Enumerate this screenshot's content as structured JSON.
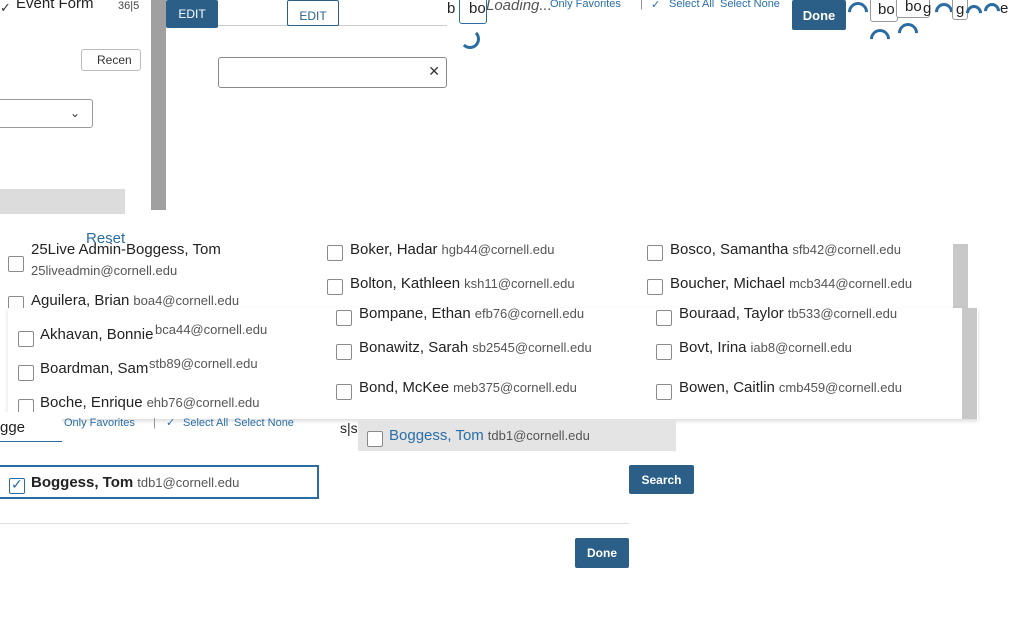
{
  "top_left": {
    "event_form": "Event Form",
    "count_text": "36|5",
    "recent": "Recen"
  },
  "edit_buttons": {
    "edit1": "EDIT",
    "edit2": "EDIT"
  },
  "top_strip": {
    "b1": "b",
    "bo1": "bo",
    "loading": "Loading...",
    "only_favorites": "Only Favorites",
    "sep": "|",
    "select_all": "Select All",
    "select_none": "Select None",
    "done": "Done",
    "bo2": "bo",
    "bo3": "bo",
    "g1": "g",
    "g2": "g",
    "e1": "e"
  },
  "reset": "Reset",
  "people_col1": [
    {
      "name": "25Live Admin-Boggess, Tom",
      "email": "25liveadmin@cornell.edu"
    },
    {
      "name": "Aguilera, Brian",
      "email": "boa4@cornell.edu"
    },
    {
      "name": "Akhavan, Bonnie",
      "email": "bca44@cornell.edu"
    },
    {
      "name": "Boardman, Sam",
      "email": "stb89@cornell.edu"
    },
    {
      "name": "Boche, Enrique",
      "email": "ehb76@cornell.edu"
    }
  ],
  "people_col2": [
    {
      "name": "Boker, Hadar",
      "email": "hgb44@cornell.edu"
    },
    {
      "name": "Bolton, Kathleen",
      "email": "ksh11@cornell.edu"
    },
    {
      "name": "Bompane, Ethan",
      "email": "efb76@cornell.edu"
    },
    {
      "name": "Bonawitz, Sarah",
      "email": "sb2545@cornell.edu"
    },
    {
      "name": "Bond, McKee",
      "email": "meb375@cornell.edu"
    }
  ],
  "people_col3": [
    {
      "name": "Bosco, Samantha",
      "email": "sfb42@cornell.edu"
    },
    {
      "name": "Boucher, Michael",
      "email": "mcb344@cornell.edu"
    },
    {
      "name": "Bouraad, Taylor",
      "email": "tb533@cornell.edu"
    },
    {
      "name": "Bovt, Irina",
      "email": "iab8@cornell.edu"
    },
    {
      "name": "Bowen, Caitlin",
      "email": "cmb459@cornell.edu"
    }
  ],
  "search_row": {
    "query_value": "gge",
    "only_favorites": "Only Favorites",
    "sep": "|",
    "select_all": "Select All",
    "select_none": "Select None",
    "ss": "s|s"
  },
  "suggestion": {
    "name": "Boggess, Tom",
    "email": "tdb1@cornell.edu"
  },
  "selected": {
    "name": "Boggess, Tom",
    "email": "tdb1@cornell.edu"
  },
  "search_button": "Search",
  "done_button": "Done"
}
